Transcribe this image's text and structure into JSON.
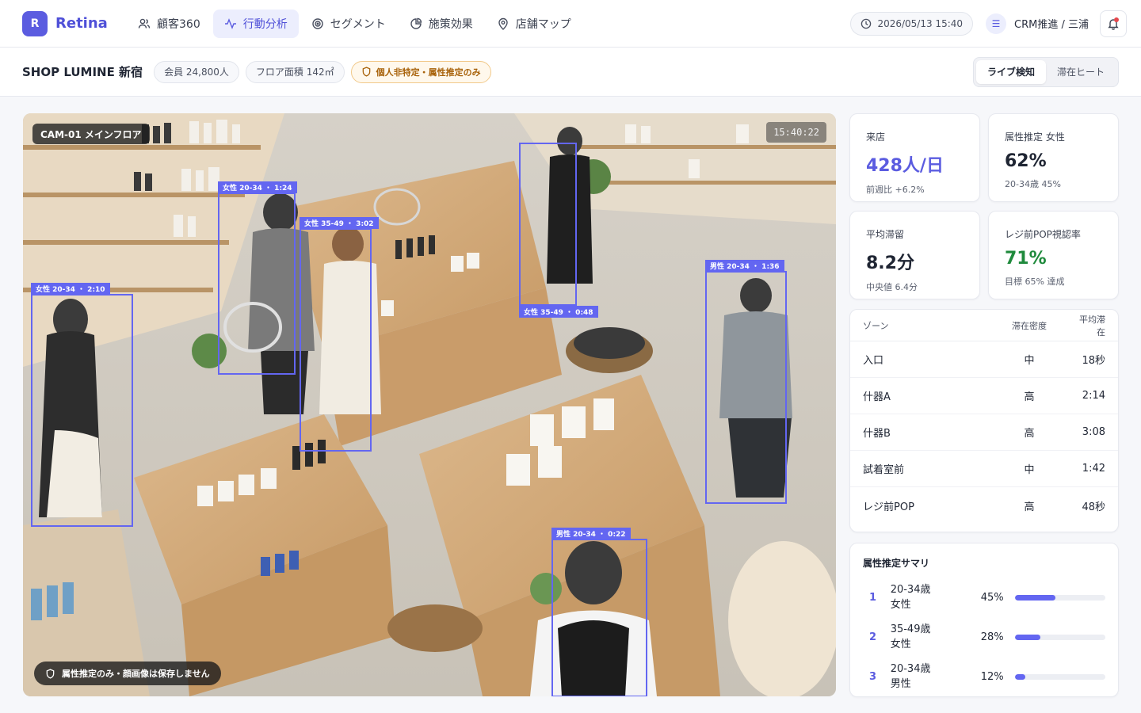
{
  "app": {
    "logo_letter": "R",
    "name": "Retina"
  },
  "nav": {
    "tabs": [
      {
        "label": "顧客360",
        "icon": "users-icon",
        "active": false
      },
      {
        "label": "行動分析",
        "icon": "activity-icon",
        "active": true
      },
      {
        "label": "セグメント",
        "icon": "target-icon",
        "active": false
      },
      {
        "label": "施策効果",
        "icon": "pie-chart-icon",
        "active": false
      },
      {
        "label": "店舗マップ",
        "icon": "map-pin-icon",
        "active": false
      }
    ],
    "datetime": "2026/05/13 15:40",
    "user_initial": "☰",
    "user_label": "CRM推進 / 三浦"
  },
  "store": {
    "name": "SHOP LUMINE 新宿",
    "members": "会員 24,800人",
    "floor_area": "フロア面積 142㎡",
    "privacy_badge": "個人非特定・属性推定のみ"
  },
  "view_toggle": {
    "live": "ライブ検知",
    "heat": "滞在ヒート",
    "active": "live"
  },
  "camera": {
    "label": "CAM-01 メインフロア",
    "time": "15:40:22",
    "privacy_note": "属性推定のみ・顔画像は保存しません",
    "detections": [
      {
        "tag": "女性 20-34 ・ 2:10"
      },
      {
        "tag": "女性 20-34 ・ 1:24"
      },
      {
        "tag": "女性 35-49 ・ 3:02"
      },
      {
        "tag": "女性 35-49 ・ 0:48"
      },
      {
        "tag": "男性 20-34 ・ 1:36"
      },
      {
        "tag": "男性 20-34 ・ 0:22"
      }
    ]
  },
  "kpis": [
    {
      "label": "来店",
      "value": "428人/日",
      "sub": "前週比 +6.2%",
      "accent": "#5b5ce0"
    },
    {
      "label": "属性推定 女性",
      "value": "62%",
      "sub": "20-34歳 45%",
      "accent": "#1f2533"
    },
    {
      "label": "平均滞留",
      "value": "8.2分",
      "sub": "中央値 6.4分",
      "accent": "#1f2533"
    },
    {
      "label": "レジ前POP視認率",
      "value": "71%",
      "sub": "目標 65% 達成",
      "accent": "#1f8a3c"
    }
  ],
  "zones": {
    "headers": {
      "name": "ゾーン",
      "density": "滞在密度",
      "dwell": "平均滞在"
    },
    "rows": [
      {
        "name": "入口",
        "density": "中",
        "dwell": "18秒"
      },
      {
        "name": "什器A",
        "density": "高",
        "dwell": "2:14"
      },
      {
        "name": "什器B",
        "density": "高",
        "dwell": "3:08"
      },
      {
        "name": "試着室前",
        "density": "中",
        "dwell": "1:42"
      },
      {
        "name": "レジ前POP",
        "density": "高",
        "dwell": "48秒"
      }
    ]
  },
  "attributes": {
    "title": "属性推定サマリ",
    "rows": [
      {
        "rank": "1",
        "line1": "20-34歳",
        "line2": "女性",
        "pct": "45%",
        "value": 45
      },
      {
        "rank": "2",
        "line1": "35-49歳",
        "line2": "女性",
        "pct": "28%",
        "value": 28
      },
      {
        "rank": "3",
        "line1": "20-34歳",
        "line2": "男性",
        "pct": "12%",
        "value": 12
      }
    ]
  },
  "colors": {
    "accent": "#5b5ce0",
    "detection": "#6366f1",
    "success": "#1f8a3c",
    "warning": "#a8620a"
  }
}
